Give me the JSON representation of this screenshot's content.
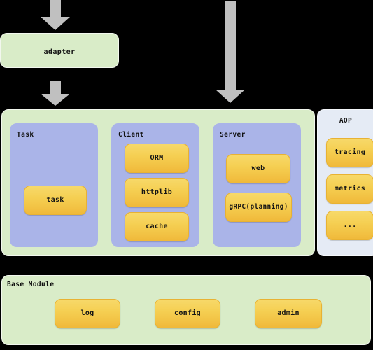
{
  "diagram": {
    "background_color": "#000000",
    "panel_green": "#d9ecc8",
    "panel_purple": "#aab4e8",
    "panel_blue": "#e5ebf5",
    "leaf_orange_top": "#f7d96a",
    "leaf_orange_bottom": "#f0b93a",
    "arrow_color": "#c0c0c0"
  },
  "adapter": {
    "label": "adapter"
  },
  "captions": {
    "top_left": "",
    "mid_left": "",
    "mid_right": ""
  },
  "main": {
    "groups": [
      {
        "title": "Task",
        "items": [
          {
            "label": "task"
          }
        ]
      },
      {
        "title": "Client",
        "items": [
          {
            "label": "ORM"
          },
          {
            "label": "httplib"
          },
          {
            "label": "cache"
          }
        ]
      },
      {
        "title": "Server",
        "items": [
          {
            "label": "web"
          },
          {
            "label": "gRPC(planning)"
          }
        ]
      }
    ]
  },
  "aop": {
    "title": "AOP",
    "items": [
      {
        "label": "tracing"
      },
      {
        "label": "metrics"
      },
      {
        "label": "..."
      }
    ]
  },
  "base_module": {
    "title": "Base Module",
    "items": [
      {
        "label": "log"
      },
      {
        "label": "config"
      },
      {
        "label": "admin"
      }
    ]
  }
}
